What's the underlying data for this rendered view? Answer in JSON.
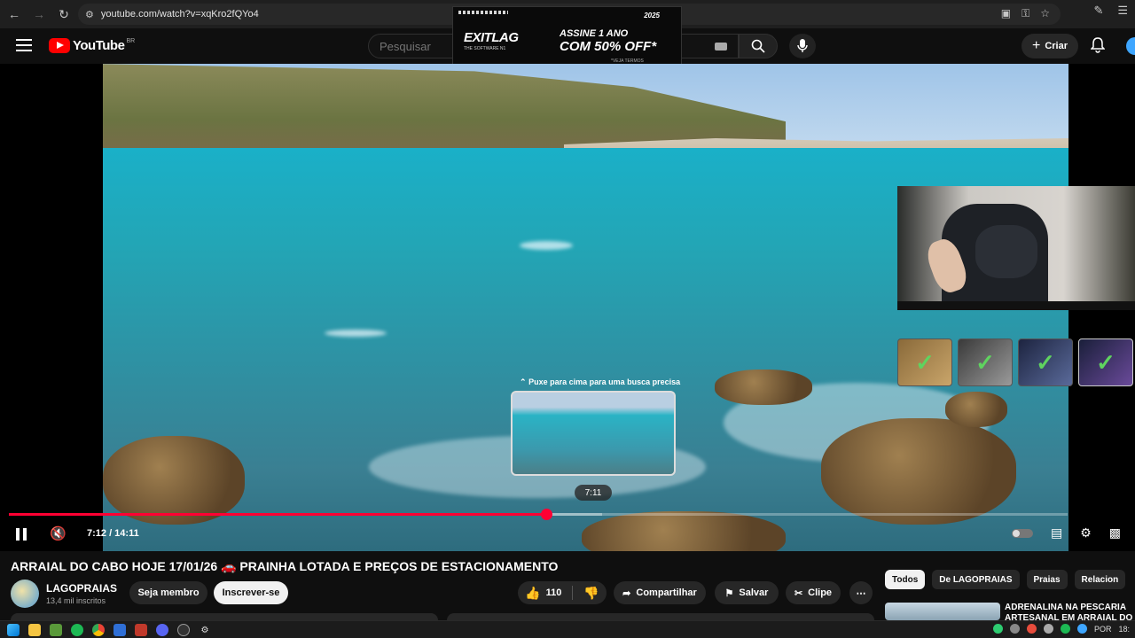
{
  "browser": {
    "url": "youtube.com/watch?v=xqKro2fQYo4"
  },
  "header": {
    "logo_text": "YouTube",
    "region": "BR",
    "search_placeholder": "Pesquisar",
    "create_label": "Criar"
  },
  "ad": {
    "brand": "EXITLAG",
    "brand_sub": "THE SOFTWARE N1",
    "line1": "ASSINE 1 ANO",
    "line2": "COM 50% OFF*",
    "note": "*VEJA TERMOS",
    "corner": "2025"
  },
  "player": {
    "seek_hint": "Puxe para cima para uma busca precisa",
    "preview_time": "7:11",
    "time_display": "7:12 / 14:11",
    "progress": 0.5076,
    "buffered": 0.56
  },
  "video": {
    "title": "ARRAIAL DO CABO HOJE 17/01/26 🚗 PRAINHA LOTADA E PREÇOS DE ESTACIONAMENTO"
  },
  "channel": {
    "name": "LAGOPRAIAS",
    "subscribers": "13,4 mil inscritos",
    "member_label": "Seja membro",
    "subscribe_label": "Inscrever-se"
  },
  "actions": {
    "likes": "110",
    "share_label": "Compartilhar",
    "save_label": "Salvar",
    "clip_label": "Clipe"
  },
  "chips": [
    "Todos",
    "De LAGOPRAIAS",
    "Praias",
    "Relacion"
  ],
  "recommendation": {
    "title": "ADRENALINA NA PESCARIA ARTESANAL EM ARRAIAL DO"
  },
  "taskbar": {
    "lang": "POR",
    "clock": "18:"
  },
  "colors": {
    "brand_red": "#ff0000",
    "progress_red": "#ff0033",
    "background": "#0f0f0f"
  }
}
